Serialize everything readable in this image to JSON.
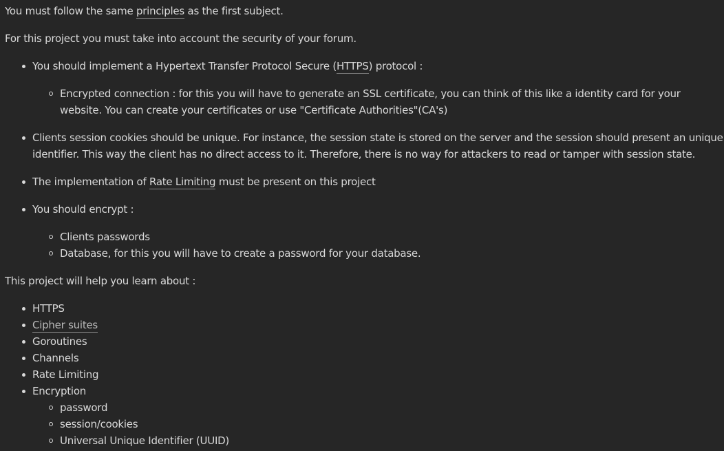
{
  "intro": {
    "before": "You must follow the same ",
    "link": "principles",
    "after": " as the first subject."
  },
  "security_intro": "For this project you must take into account the security of your forum.",
  "requirements": {
    "https": {
      "before": "You should implement a Hypertext Transfer Protocol Secure (",
      "link": "HTTPS",
      "after": ") protocol :",
      "sub": "Encrypted connection : for this you will have to generate an SSL certificate, you can think of this like a identity card for your website. You can create your certificates or use \"Certificate Authorities\"(CA's)"
    },
    "cookies": "Clients session cookies should be unique. For instance, the session state is stored on the server and the session should present an unique identifier. This way the client has no direct access to it. Therefore, there is no way for attackers to read or tamper with session state.",
    "rate_limiting": {
      "before": "The implementation of ",
      "link": "Rate Limiting",
      "after": " must be present on this project"
    },
    "encrypt": {
      "label": "You should encrypt :",
      "items": [
        "Clients passwords",
        "Database, for this you will have to create a password for your database."
      ]
    }
  },
  "learn_intro": "This project will help you learn about :",
  "learn_items": [
    "HTTPS",
    "Cipher suites",
    "Goroutines",
    "Channels",
    "Rate Limiting",
    "Encryption"
  ],
  "encryption_sub": [
    "password",
    "session/cookies",
    "Universal Unique Identifier (UUID)"
  ]
}
